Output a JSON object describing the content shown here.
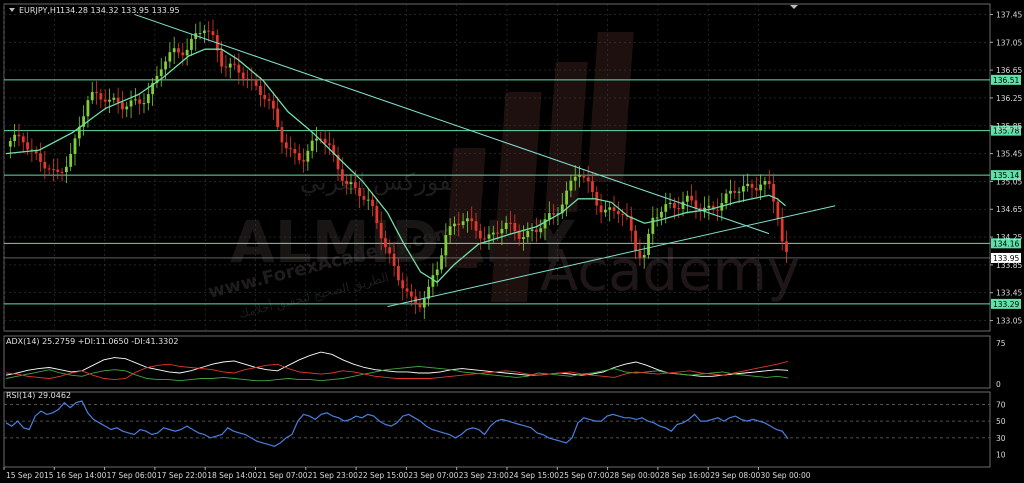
{
  "header": {
    "symbol": "EURJPY,H1",
    "ohlc": "134.28 134.32 133.95 133.95",
    "adx": "ADX(14) 25.2759 +DI:11.0650 -DI:41.3302",
    "rsi": "RSI(14) 29.0462"
  },
  "watermark": {
    "brand": "ALMIDANY",
    "academy": "Academy",
    "site": "www.ForexAcademy.com",
    "arabic_top": "الفوركس العربي",
    "arabic_bottom": "الطريق الصحيح لتحقيق أحلامك"
  },
  "colors": {
    "background": "#000000",
    "grid": "#3a3a3a",
    "bull": "#7fcf3a",
    "bear": "#e0382c",
    "ma": "#6fe0a8",
    "levels": "#5fe0a8",
    "trendline": "#7ee0d0",
    "adx_main": "#ffffff",
    "plus_di": "#3fa83f",
    "minus_di": "#e0382c",
    "rsi": "#4a7fe0",
    "price_tag": "#ffffff"
  },
  "chart_data": [
    {
      "type": "candlestick",
      "symbol": "EURJPY",
      "timeframe": "H1",
      "ylim": [
        132.9,
        137.6
      ],
      "yticks": [
        "137.45",
        "137.05",
        "136.65",
        "136.25",
        "135.85",
        "135.45",
        "135.05",
        "134.65",
        "134.25",
        "133.85",
        "133.45",
        "133.05"
      ],
      "levels": [
        {
          "value": 136.51,
          "label": "136.51"
        },
        {
          "value": 135.78,
          "label": "135.78"
        },
        {
          "value": 135.14,
          "label": "135.14"
        },
        {
          "value": 134.16,
          "label": "134.16"
        },
        {
          "value": 133.29,
          "label": "133.29"
        }
      ],
      "current_price": {
        "value": 133.95,
        "label": "133.95"
      },
      "x_labels": [
        "15 Sep 2015",
        "16 Sep 14:00",
        "17 Sep 06:00",
        "17 Sep 22:00",
        "18 Sep 14:00",
        "21 Sep 07:00",
        "21 Sep 23:00",
        "22 Sep 15:00",
        "23 Sep 07:00",
        "23 Sep 23:00",
        "24 Sep 15:00",
        "25 Sep 07:00",
        "28 Sep 00:00",
        "28 Sep 16:00",
        "29 Sep 08:00",
        "30 Sep 00:00"
      ],
      "close_path": [
        [
          0,
          135.55
        ],
        [
          2,
          135.7
        ],
        [
          4,
          135.35
        ],
        [
          6,
          135.1
        ],
        [
          8,
          135.5
        ],
        [
          10,
          136.25
        ],
        [
          12,
          136.3
        ],
        [
          14,
          136.1
        ],
        [
          16,
          136.2
        ],
        [
          18,
          136.45
        ],
        [
          19,
          136.75
        ],
        [
          20,
          136.9
        ],
        [
          22,
          137.0
        ],
        [
          24,
          137.25
        ],
        [
          25,
          137.1
        ],
        [
          26,
          136.8
        ],
        [
          28,
          136.6
        ],
        [
          30,
          136.45
        ],
        [
          31,
          136.35
        ],
        [
          32,
          136.1
        ],
        [
          33,
          135.7
        ],
        [
          34,
          135.5
        ],
        [
          36,
          135.4
        ],
        [
          38,
          135.7
        ],
        [
          39,
          135.55
        ],
        [
          40,
          135.3
        ],
        [
          41,
          135.0
        ],
        [
          42,
          134.9
        ],
        [
          43,
          134.85
        ],
        [
          44,
          134.75
        ],
        [
          45,
          134.4
        ],
        [
          46,
          134.0
        ],
        [
          47,
          133.7
        ],
        [
          48,
          133.55
        ],
        [
          49,
          133.35
        ],
        [
          50,
          133.3
        ],
        [
          51,
          133.45
        ],
        [
          52,
          133.8
        ],
        [
          53,
          134.3
        ],
        [
          54,
          134.45
        ],
        [
          55,
          134.5
        ],
        [
          56,
          134.4
        ],
        [
          58,
          134.25
        ],
        [
          60,
          134.4
        ],
        [
          62,
          134.3
        ],
        [
          64,
          134.35
        ],
        [
          66,
          134.55
        ],
        [
          68,
          135.0
        ],
        [
          69,
          135.2
        ],
        [
          70,
          135.0
        ],
        [
          72,
          134.65
        ],
        [
          74,
          134.6
        ],
        [
          75,
          134.45
        ],
        [
          76,
          134.1
        ],
        [
          77,
          134.0
        ],
        [
          78,
          134.5
        ],
        [
          80,
          134.7
        ],
        [
          82,
          134.8
        ],
        [
          84,
          134.6
        ],
        [
          86,
          134.75
        ],
        [
          88,
          134.9
        ],
        [
          90,
          135.0
        ],
        [
          91,
          135.05
        ],
        [
          92,
          134.95
        ],
        [
          93,
          134.6
        ],
        [
          93.7,
          134.1
        ],
        [
          94.3,
          133.95
        ]
      ],
      "moving_average_path": [
        [
          0,
          135.45
        ],
        [
          4,
          135.5
        ],
        [
          8,
          135.75
        ],
        [
          12,
          136.1
        ],
        [
          16,
          136.3
        ],
        [
          19,
          136.55
        ],
        [
          22,
          136.85
        ],
        [
          24,
          136.95
        ],
        [
          26,
          136.95
        ],
        [
          28,
          136.8
        ],
        [
          31,
          136.5
        ],
        [
          34,
          136.05
        ],
        [
          37,
          135.75
        ],
        [
          40,
          135.4
        ],
        [
          43,
          135.05
        ],
        [
          46,
          134.6
        ],
        [
          48,
          134.15
        ],
        [
          50,
          133.75
        ],
        [
          52,
          133.6
        ],
        [
          54,
          133.85
        ],
        [
          57,
          134.15
        ],
        [
          61,
          134.3
        ],
        [
          64,
          134.4
        ],
        [
          67,
          134.6
        ],
        [
          69,
          134.8
        ],
        [
          71,
          134.8
        ],
        [
          73,
          134.75
        ],
        [
          75,
          134.55
        ],
        [
          77,
          134.45
        ],
        [
          79,
          134.5
        ],
        [
          82,
          134.6
        ],
        [
          85,
          134.65
        ],
        [
          88,
          134.75
        ],
        [
          90,
          134.8
        ],
        [
          92,
          134.85
        ],
        [
          93,
          134.8
        ],
        [
          94,
          134.7
        ]
      ],
      "trendlines": [
        {
          "from": [
            15.5,
            137.45
          ],
          "to": [
            92,
            134.3
          ]
        },
        {
          "from": [
            46,
            133.25
          ],
          "to": [
            100,
            134.7
          ]
        }
      ]
    },
    {
      "type": "line",
      "indicator": "ADX(14)",
      "ylim": [
        0,
        80
      ],
      "yticks": [
        "75",
        "0"
      ],
      "series": [
        {
          "name": "ADX",
          "values": [
            16,
            20,
            25,
            28,
            30,
            26,
            22,
            24,
            34,
            44,
            48,
            46,
            38,
            30,
            26,
            22,
            20,
            24,
            30,
            36,
            40,
            42,
            36,
            30,
            26,
            24,
            34,
            44,
            52,
            58,
            54,
            44,
            36,
            30,
            26,
            24,
            22,
            22,
            20,
            20,
            22,
            26,
            28,
            26,
            24,
            22,
            20,
            18,
            16,
            16,
            18,
            20,
            18,
            16,
            18,
            22,
            30,
            36,
            40,
            34,
            26,
            20,
            18,
            16,
            14,
            14,
            16,
            18,
            20,
            22,
            24,
            26,
            25
          ]
        },
        {
          "name": "+DI",
          "values": [
            10,
            14,
            18,
            22,
            26,
            20,
            16,
            14,
            20,
            24,
            26,
            24,
            16,
            10,
            8,
            8,
            6,
            8,
            10,
            10,
            12,
            10,
            8,
            6,
            6,
            8,
            10,
            8,
            8,
            6,
            8,
            10,
            14,
            18,
            22,
            26,
            28,
            30,
            32,
            30,
            28,
            26,
            22,
            20,
            18,
            16,
            14,
            12,
            14,
            20,
            18,
            16,
            14,
            18,
            20,
            24,
            28,
            22,
            20,
            22,
            24,
            20,
            18,
            16,
            18,
            20,
            22,
            18,
            16,
            14,
            12,
            14,
            11
          ]
        },
        {
          "name": "-DI",
          "values": [
            20,
            18,
            14,
            12,
            10,
            14,
            20,
            24,
            16,
            10,
            8,
            10,
            22,
            30,
            34,
            36,
            32,
            30,
            28,
            26,
            22,
            20,
            26,
            30,
            34,
            36,
            28,
            22,
            20,
            18,
            20,
            24,
            22,
            18,
            14,
            12,
            10,
            10,
            10,
            10,
            12,
            14,
            16,
            18,
            20,
            22,
            24,
            22,
            18,
            16,
            18,
            20,
            22,
            18,
            16,
            14,
            12,
            18,
            22,
            20,
            18,
            20,
            22,
            24,
            20,
            18,
            16,
            20,
            24,
            28,
            32,
            36,
            41
          ]
        }
      ]
    },
    {
      "type": "line",
      "indicator": "RSI(14)",
      "ylim": [
        0,
        80
      ],
      "yticks": [
        "70",
        "50",
        "30",
        "10"
      ],
      "levels": [
        70,
        50,
        30
      ],
      "series": [
        {
          "name": "RSI",
          "values": [
            48,
            44,
            50,
            42,
            40,
            56,
            62,
            58,
            60,
            64,
            72,
            66,
            72,
            74,
            60,
            52,
            48,
            44,
            40,
            42,
            38,
            36,
            34,
            40,
            38,
            34,
            36,
            42,
            40,
            38,
            40,
            44,
            40,
            36,
            34,
            30,
            32,
            34,
            42,
            38,
            36,
            34,
            30,
            26,
            24,
            22,
            20,
            24,
            30,
            34,
            50,
            58,
            56,
            52,
            58,
            60,
            56,
            54,
            50,
            52,
            56,
            54,
            58,
            56,
            50,
            46,
            44,
            48,
            56,
            58,
            54,
            50,
            44,
            40,
            38,
            36,
            34,
            30,
            34,
            40,
            42,
            40,
            34,
            44,
            50,
            52,
            50,
            48,
            46,
            44,
            42,
            36,
            34,
            30,
            28,
            26,
            24,
            30,
            48,
            54,
            52,
            50,
            50,
            56,
            58,
            56,
            54,
            54,
            52,
            54,
            50,
            48,
            44,
            42,
            38,
            46,
            48,
            52,
            58,
            50,
            50,
            52,
            54,
            50,
            54,
            56,
            52,
            50,
            52,
            50,
            48,
            44,
            40,
            38,
            29
          ]
        }
      ]
    }
  ]
}
